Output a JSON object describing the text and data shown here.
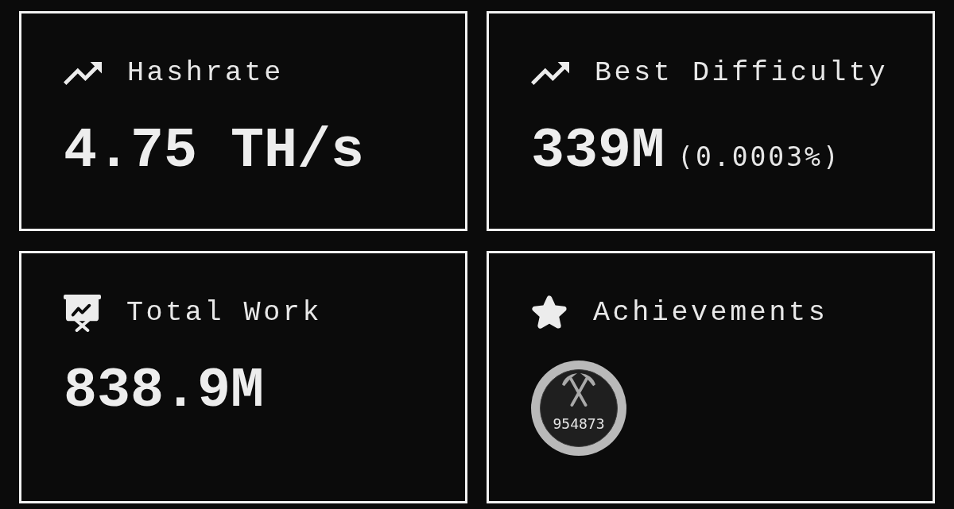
{
  "cards": [
    {
      "kind": "hashrate",
      "title": "Hashrate",
      "value": "4.75 TH/s"
    },
    {
      "kind": "difficulty",
      "title": "Best Difficulty",
      "value": "339M",
      "detail": "(0.0003%)"
    },
    {
      "kind": "work",
      "title": "Total Work",
      "value": "838.9M"
    },
    {
      "kind": "achievements",
      "title": "Achievements",
      "badges": [
        {
          "label": "954873"
        }
      ]
    }
  ]
}
